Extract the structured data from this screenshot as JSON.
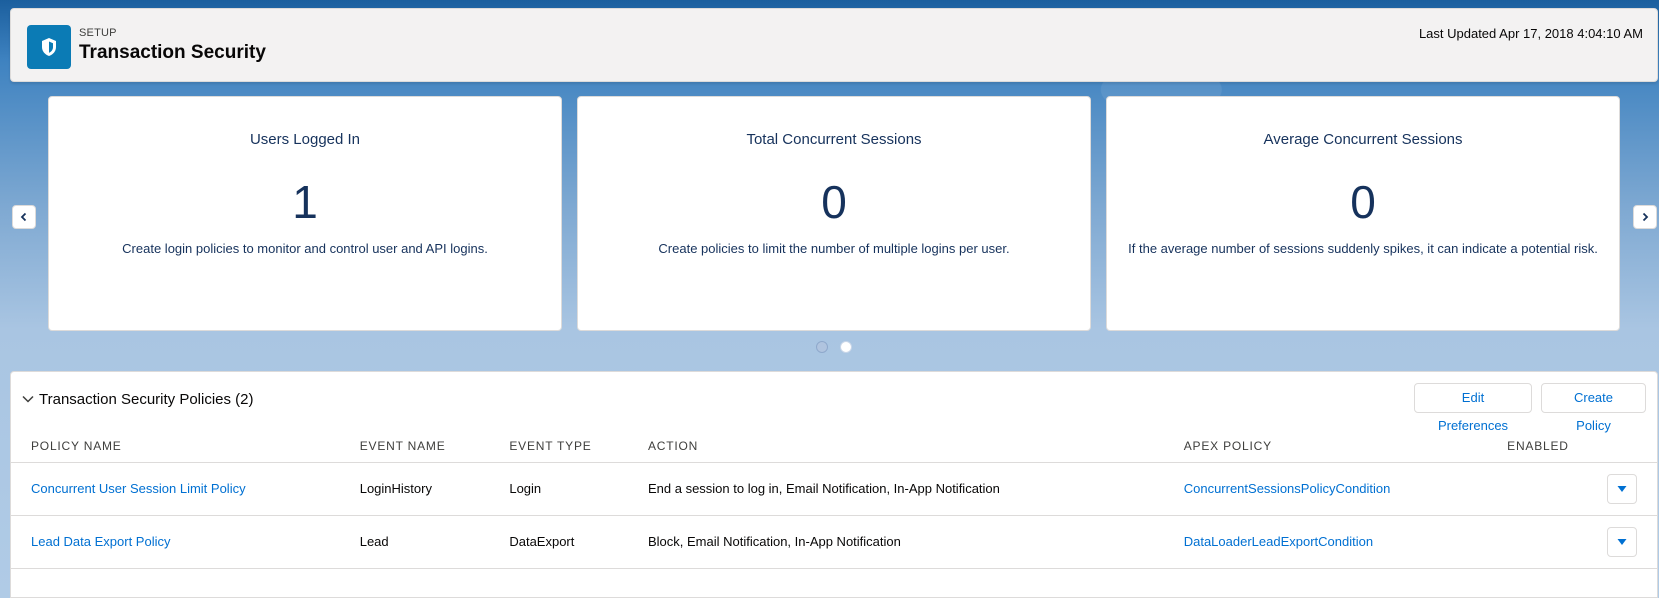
{
  "header": {
    "eyebrow": "SETUP",
    "title": "Transaction Security",
    "last_updated": "Last Updated Apr 17, 2018 4:04:10 AM",
    "icon": "shield-icon"
  },
  "carousel": {
    "cards": [
      {
        "title": "Users Logged In",
        "value": "1",
        "description": "Create login policies to monitor and control user and API logins."
      },
      {
        "title": "Total Concurrent Sessions",
        "value": "0",
        "description": "Create policies to limit the number of multiple logins per user."
      },
      {
        "title": "Average Concurrent Sessions",
        "value": "0",
        "description": "If the average number of sessions suddenly spikes, it can indicate a potential risk."
      }
    ],
    "page_count": 2,
    "active_page": 1
  },
  "policies": {
    "title": "Transaction Security Policies (2)",
    "edit_label": "Edit Preferences",
    "create_label": "Create Policy",
    "columns": [
      "POLICY NAME",
      "EVENT NAME",
      "EVENT TYPE",
      "ACTION",
      "APEX POLICY",
      "ENABLED"
    ],
    "rows": [
      {
        "name": "Concurrent User Session Limit Policy",
        "event_name": "LoginHistory",
        "event_type": "Login",
        "action": "End a session to log in, Email Notification, In-App Notification",
        "apex": "ConcurrentSessionsPolicyCondition"
      },
      {
        "name": "Lead Data Export Policy",
        "event_name": "Lead",
        "event_type": "DataExport",
        "action": "Block, Email Notification, In-App Notification",
        "apex": "DataLoaderLeadExportCondition"
      }
    ]
  },
  "colors": {
    "brand": "#0b7bb5",
    "link": "#0070d2",
    "card_text": "#16325c"
  }
}
